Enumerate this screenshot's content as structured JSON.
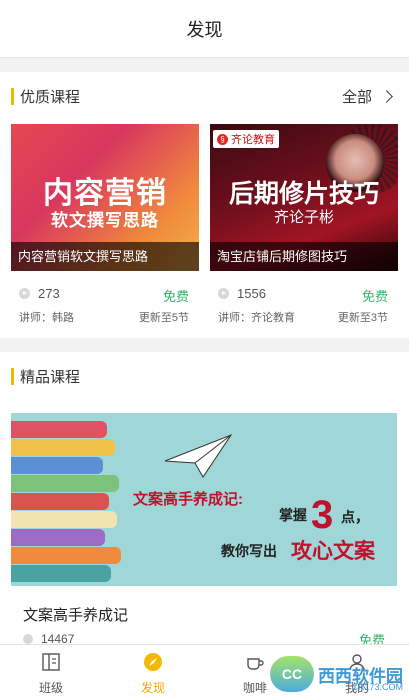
{
  "topbar": {
    "title": "发现"
  },
  "section1": {
    "label": "优质课程",
    "more": "全部",
    "cards": [
      {
        "thumb_line1": "内容营销",
        "thumb_line2": "软文撰写思路",
        "caption": "内容营销软文撰写思路",
        "views": "273",
        "price": "免费",
        "teacher": "讲师：韩路",
        "update": "更新至5节"
      },
      {
        "brand": "齐论教育",
        "thumb_line1": "后期修片技巧",
        "thumb_line2": "齐论子彬",
        "caption": "淘宝店铺后期修图技巧",
        "views": "1556",
        "price": "免费",
        "teacher": "讲师：齐论教育",
        "update": "更新至3节"
      }
    ]
  },
  "section2": {
    "label": "精品课程",
    "banner": {
      "line1": "文案高手养成记:",
      "grasp": "掌握",
      "three": "3",
      "points": "点，",
      "line3": "教你写出",
      "line3_highlight": "攻心文案"
    },
    "course": {
      "title": "文案高手养成记",
      "views": "14467",
      "price": "免费"
    }
  },
  "tabbar": {
    "items": [
      {
        "label": "班级",
        "icon": "book-icon"
      },
      {
        "label": "发现",
        "icon": "compass-icon"
      },
      {
        "label": "咖啡",
        "icon": "coffee-icon"
      },
      {
        "label": "我的",
        "icon": "person-icon"
      }
    ]
  },
  "watermark": {
    "logo": "CC",
    "text": "西西软件园",
    "sub": "CR173.COM"
  },
  "colors": {
    "accent": "#f5b800",
    "free_green": "#36b36b",
    "banner_bg": "#9fd6d7",
    "banner_red": "#c0122e"
  }
}
